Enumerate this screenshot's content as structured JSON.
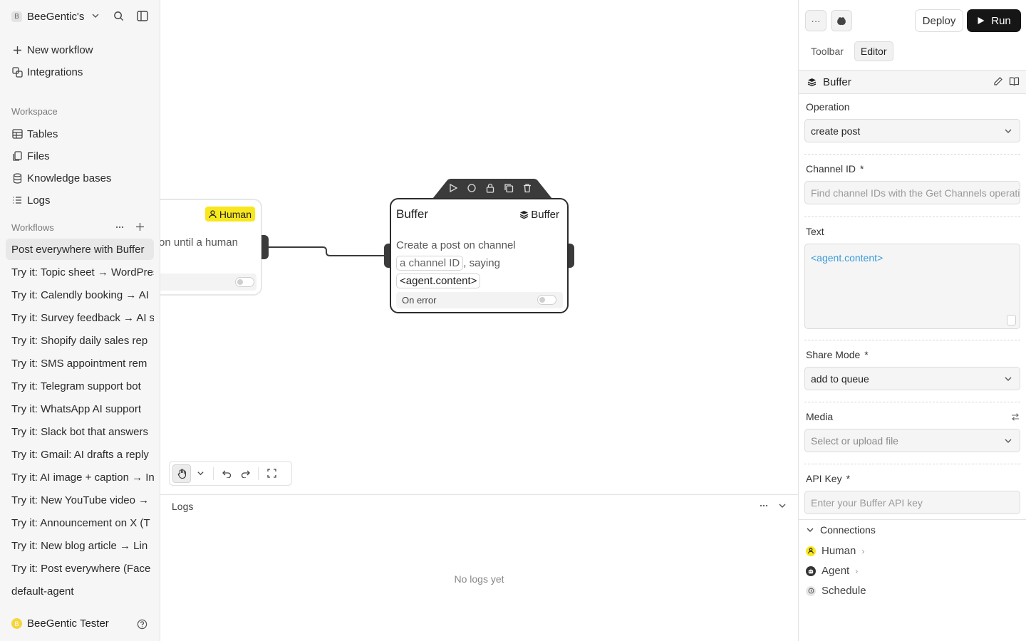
{
  "sidebar": {
    "workspace_badge": "B",
    "workspace_name": "BeeGentic's",
    "new_workflow": "New workflow",
    "integrations": "Integrations",
    "workspace_label": "Workspace",
    "nav": [
      "Tables",
      "Files",
      "Knowledge bases",
      "Logs"
    ],
    "workflows_label": "Workflows",
    "workflows": [
      "Post everywhere with Buffer",
      "Try it: Topic sheet → WordPress",
      "Try it: Calendly booking → AI",
      "Try it: Survey feedback → AI s",
      "Try it: Shopify daily sales rep",
      "Try it: SMS appointment rem",
      "Try it: Telegram support bot",
      "Try it: WhatsApp AI support",
      "Try it: Slack bot that answers",
      "Try it: Gmail: AI drafts a reply",
      "Try it: AI image + caption → In",
      "Try it: New YouTube video →",
      "Try it: Announcement on X (T",
      "Try it: New blog article → Lin",
      "Try it: Post everywhere (Face",
      "default-agent"
    ],
    "user_initial": "B",
    "user_name": "BeeGentic Tester"
  },
  "canvas": {
    "human_node": {
      "badge": "Human",
      "description": "on until a human"
    },
    "buffer_node": {
      "title": "Buffer",
      "badge": "Buffer",
      "desc_prefix": "Create a post on channel",
      "chip_channel": "a channel ID",
      "desc_mid": ", saying",
      "chip_content": "<agent.content>",
      "on_error": "On error"
    }
  },
  "logs": {
    "title": "Logs",
    "empty": "No logs yet"
  },
  "panel": {
    "more_label": "···",
    "deploy": "Deploy",
    "run": "Run",
    "tabs": [
      "Toolbar",
      "Editor"
    ],
    "active_tab": "Editor",
    "block_title": "Buffer",
    "operation": {
      "label": "Operation",
      "value": "create post"
    },
    "channel_id": {
      "label": "Channel ID",
      "required": "*",
      "placeholder": "Find channel IDs with the Get Channels operation"
    },
    "text": {
      "label": "Text",
      "value": "<agent.content>"
    },
    "share_mode": {
      "label": "Share Mode",
      "required": "*",
      "value": "add to queue"
    },
    "media": {
      "label": "Media",
      "placeholder": "Select or upload file"
    },
    "api_key": {
      "label": "API Key",
      "required": "*",
      "placeholder": "Enter your Buffer API key"
    },
    "connections": {
      "label": "Connections",
      "items": [
        "Human",
        "Agent",
        "Schedule"
      ]
    }
  },
  "colors": {
    "accent_yellow": "#f9e71e",
    "text_link": "#3b9bd9",
    "run_bg": "#161616"
  }
}
